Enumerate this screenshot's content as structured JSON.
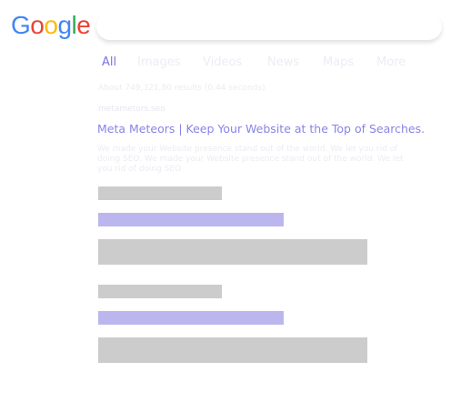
{
  "logo": {
    "letters": [
      {
        "char": "G",
        "color": "#4285F4"
      },
      {
        "char": "o",
        "color": "#EA4335"
      },
      {
        "char": "o",
        "color": "#FBBC05"
      },
      {
        "char": "g",
        "color": "#4285F4"
      },
      {
        "char": "l",
        "color": "#34A853"
      },
      {
        "char": "e",
        "color": "#EA4335"
      }
    ]
  },
  "search": {
    "value": ""
  },
  "tabs": [
    {
      "label": "All",
      "active": true
    },
    {
      "label": "Images",
      "active": false
    },
    {
      "label": "Videos",
      "active": false
    },
    {
      "label": "News",
      "active": false
    },
    {
      "label": "Maps",
      "active": false
    },
    {
      "label": "More",
      "active": false
    }
  ],
  "results": {
    "stats": "About 749,321,80 results (0.44 seconds)",
    "items": [
      {
        "url": "metametors.seo",
        "title": "Meta Meteors | Keep Your Website at the Top of Searches.",
        "snippet": "We made your Website presence stand out of the world. We let you rid of doing SEO. We made your Website presence stand out of the world. We let you rid of doing SEO"
      }
    ]
  },
  "colors": {
    "accent": "#7a74e3",
    "placeholder_gray": "#cccccc",
    "placeholder_purple": "#bbb7ee"
  }
}
